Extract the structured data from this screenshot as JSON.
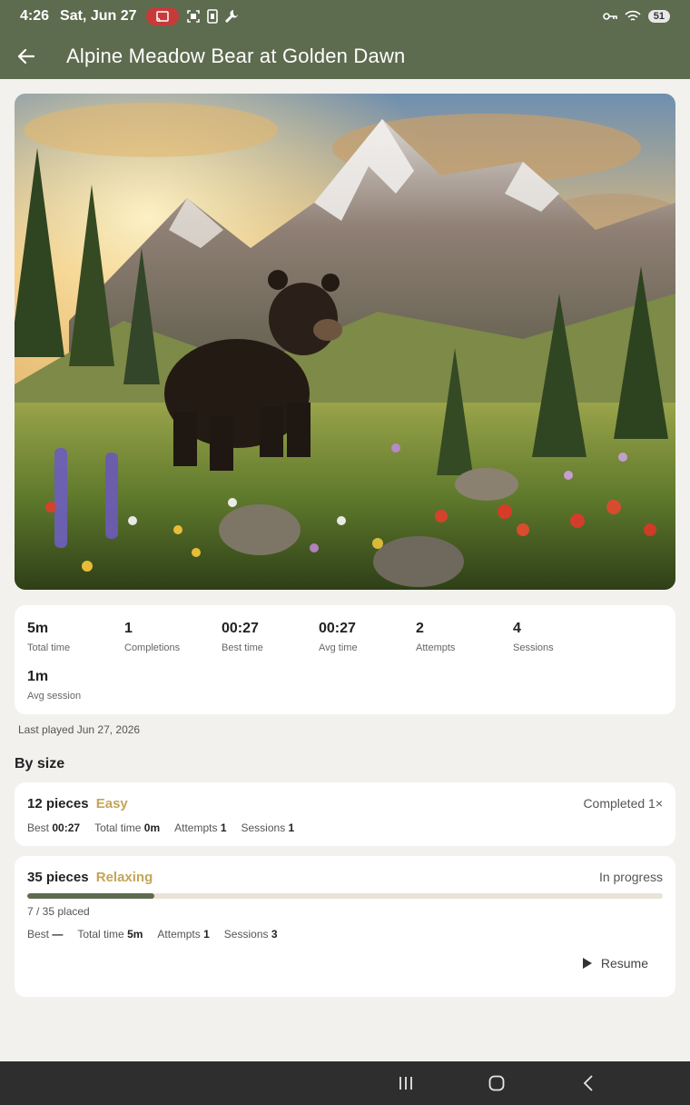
{
  "status_bar": {
    "time": "4:26",
    "date": "Sat, Jun 27",
    "battery": "51",
    "icons": [
      "cast-icon",
      "screenshot-icon",
      "phone-icon",
      "wrench-icon",
      "vpn-key-icon",
      "wifi-icon",
      "battery-icon"
    ]
  },
  "app_bar": {
    "title": "Alpine Meadow Bear at Golden Dawn",
    "back_icon": "arrow-back-icon"
  },
  "stats": [
    {
      "value": "5m",
      "label": "Total time"
    },
    {
      "value": "1",
      "label": "Completions"
    },
    {
      "value": "00:27",
      "label": "Best time"
    },
    {
      "value": "00:27",
      "label": "Avg time"
    },
    {
      "value": "2",
      "label": "Attempts"
    },
    {
      "value": "4",
      "label": "Sessions"
    },
    {
      "value": "1m",
      "label": "Avg session"
    }
  ],
  "last_played": "Last played Jun 27, 2026",
  "by_size": {
    "title": "By size",
    "items": [
      {
        "pieces": "12 pieces",
        "difficulty": "Easy",
        "status": "Completed 1×",
        "best_label": "Best",
        "best_value": "00:27",
        "total_label": "Total time",
        "total_value": "0m",
        "attempts_label": "Attempts",
        "attempts_value": "1",
        "sessions_label": "Sessions",
        "sessions_value": "1"
      },
      {
        "pieces": "35 pieces",
        "difficulty": "Relaxing",
        "status": "In progress",
        "progress": 0.2,
        "placed": "7 / 35 placed",
        "best_label": "Best",
        "best_value": "—",
        "total_label": "Total time",
        "total_value": "5m",
        "attempts_label": "Attempts",
        "attempts_value": "1",
        "sessions_label": "Sessions",
        "sessions_value": "3",
        "resume_label": "Resume"
      }
    ]
  },
  "colors": {
    "primary": "#5d6b4e",
    "accent": "#c4a458",
    "background": "#f2f1ee"
  }
}
